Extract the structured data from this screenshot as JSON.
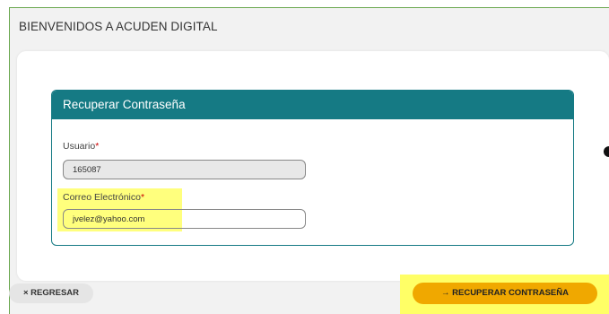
{
  "header": {
    "title": "BIENVENIDOS A ACUDEN DIGITAL"
  },
  "panel": {
    "title": "Recuperar Contraseña"
  },
  "form": {
    "usuario": {
      "label": "Usuario",
      "required_mark": "*",
      "value": "165087"
    },
    "correo": {
      "label": "Correo Electrónico",
      "required_mark": "*",
      "value": "jvelez@yahoo.com"
    }
  },
  "actions": {
    "back_label": "× REGRESAR",
    "recover_label": "→ RECUPERAR CONTRASEÑA"
  },
  "colors": {
    "accent": "#157a84",
    "primary_button": "#f0a800",
    "highlight": "#ffff66",
    "frame_border": "#6aa84f"
  }
}
